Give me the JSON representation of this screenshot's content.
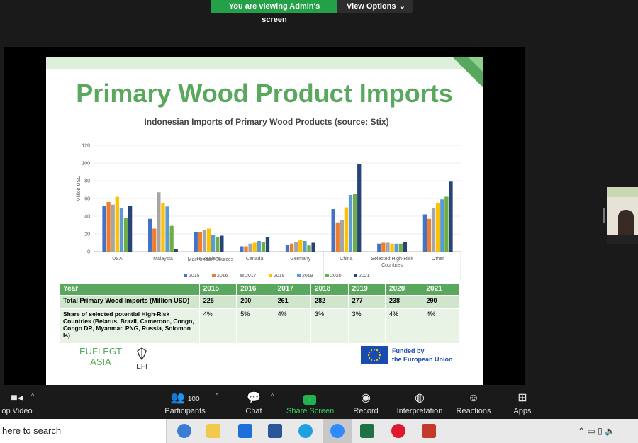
{
  "banner": {
    "status": "You are viewing Admin's screen",
    "options": "View Options"
  },
  "slide": {
    "title": "Primary Wood Product Imports",
    "chart_title": "Indonesian Imports of Primary Wood Products (source: Stix)",
    "chart_data": {
      "type": "bar",
      "title": "Indonesian Imports of Primary Wood Products (source: Stix)",
      "ylabel": "Million USD",
      "ylim": [
        0,
        120
      ],
      "yticks": [
        "0",
        "20",
        "40",
        "60",
        "80",
        "100",
        "120"
      ],
      "categories": [
        "USA",
        "Malaysia",
        "N. Zealand",
        "Canada",
        "Germany",
        "China",
        "Selected High-Risk Countries",
        "Other"
      ],
      "group_label": "Main Import Sources",
      "series": [
        {
          "name": "2015",
          "color": "#4472c4",
          "values": [
            52,
            37,
            22,
            6,
            8,
            48,
            9,
            42
          ]
        },
        {
          "name": "2016",
          "color": "#ed7d31",
          "values": [
            56,
            26,
            22,
            6,
            9,
            33,
            10,
            37
          ]
        },
        {
          "name": "2017",
          "color": "#a5a5a5",
          "values": [
            53,
            67,
            24,
            9,
            11,
            36,
            10,
            49
          ]
        },
        {
          "name": "2018",
          "color": "#ffc000",
          "values": [
            62,
            55,
            26,
            10,
            13,
            50,
            9,
            55
          ]
        },
        {
          "name": "2019",
          "color": "#5b9bd5",
          "values": [
            49,
            51,
            19,
            12,
            12,
            64,
            9,
            59
          ]
        },
        {
          "name": "2020",
          "color": "#70ad47",
          "values": [
            38,
            29,
            16,
            11,
            7,
            65,
            9,
            62
          ]
        },
        {
          "name": "2021",
          "color": "#264478",
          "values": [
            52,
            3,
            18,
            16,
            10,
            99,
            11,
            79
          ]
        }
      ],
      "legend_position": "bottom"
    },
    "table": {
      "header": [
        "Year",
        "2015",
        "2016",
        "2017",
        "2018",
        "2019",
        "2020",
        "2021"
      ],
      "row1": [
        "Total Primary Wood Imports (Million USD)",
        "225",
        "200",
        "261",
        "282",
        "277",
        "238",
        "290"
      ],
      "row2": [
        "Share of selected potential High-Risk Countries (Belarus, Brazil, Cameroon, Congo, Congo DR, Myanmar, PNG, Russia, Solomon Is)",
        "4%",
        "5%",
        "4%",
        "3%",
        "3%",
        "4%",
        "4%"
      ]
    },
    "logos": {
      "euflegt_1": "EUFLEGT",
      "euflegt_2": "ASIA",
      "efi": "EFI",
      "funded_1": "Funded by",
      "funded_2": "the European Union"
    }
  },
  "toolbar": {
    "video": "op Video",
    "participants": "Participants",
    "participants_count": "100",
    "chat": "Chat",
    "share": "Share Screen",
    "record": "Record",
    "interpretation": "Interpretation",
    "reactions": "Reactions",
    "apps": "Apps"
  },
  "taskbar": {
    "search": "here to search"
  }
}
